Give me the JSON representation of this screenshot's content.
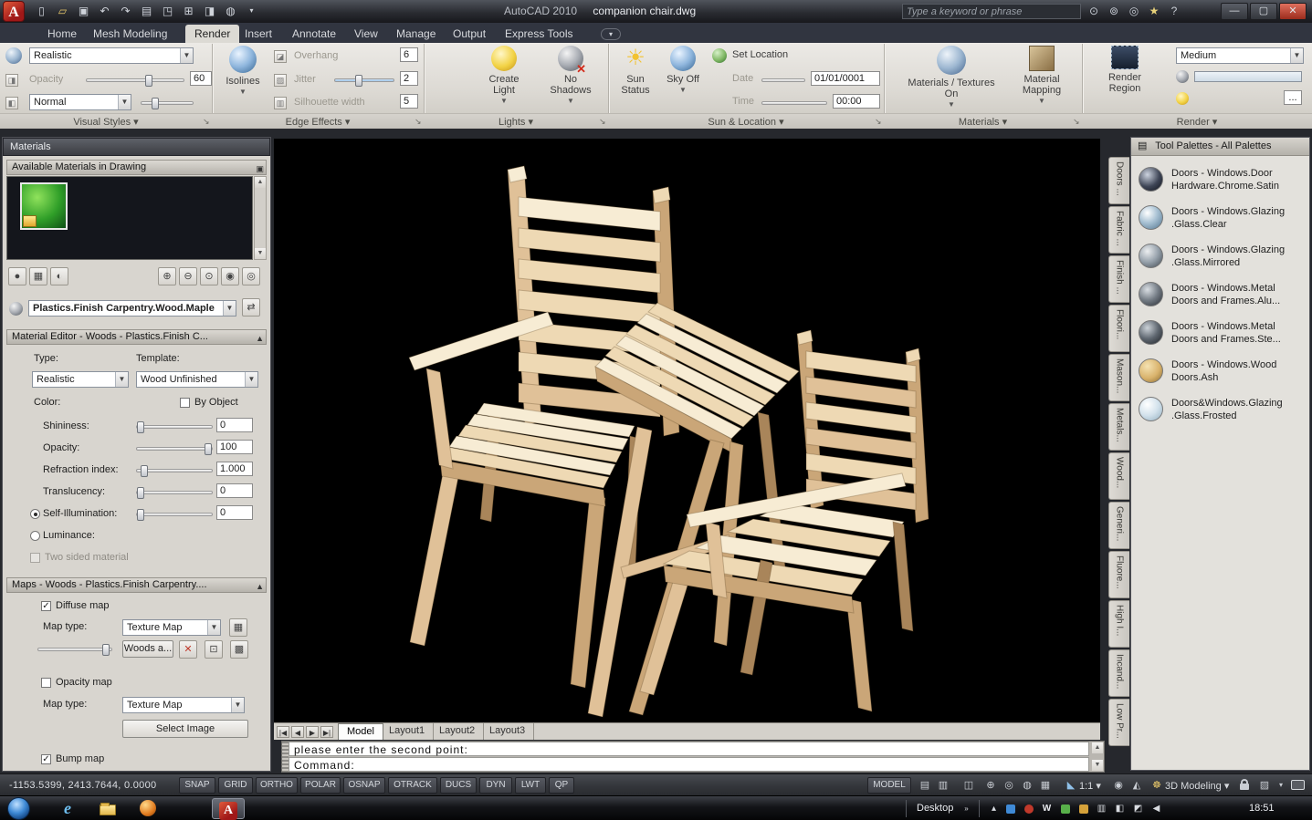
{
  "titlebar": {
    "app_title": "AutoCAD 2010",
    "doc_title": "companion chair.dwg",
    "search_placeholder": "Type a keyword or phrase"
  },
  "ribbon": {
    "tabs": [
      "Home",
      "Mesh Modeling",
      "Render",
      "Insert",
      "Annotate",
      "View",
      "Manage",
      "Output",
      "Express Tools"
    ],
    "visual_styles": {
      "style_value": "Realistic",
      "opacity_label": "Opacity",
      "opacity_value": "60",
      "face_mode_value": "Normal",
      "panel_label": "Visual Styles"
    },
    "edge_effects": {
      "isolines_label": "Isolines",
      "rows": [
        {
          "label": "Overhang",
          "value": "6"
        },
        {
          "label": "Jitter",
          "value": "2"
        },
        {
          "label": "Silhouette width",
          "value": "5"
        }
      ],
      "panel_label": "Edge Effects"
    },
    "lights": {
      "create_light": "Create Light",
      "no_shadows": "No Shadows",
      "panel_label": "Lights"
    },
    "sun_location": {
      "sun_status": "Sun Status",
      "sky_off": "Sky Off",
      "set_location": "Set Location",
      "date_label": "Date",
      "date_value": "01/01/0001",
      "time_label": "Time",
      "time_value": "00:00",
      "panel_label": "Sun & Location"
    },
    "materials": {
      "textures_on": "Materials / Textures On",
      "mapping": "Material Mapping",
      "panel_label": "Materials"
    },
    "render": {
      "region": "Render Region",
      "quality_value": "Medium",
      "more_label": "...",
      "panel_label": "Render"
    }
  },
  "materials_palette": {
    "title": "Materials",
    "header": "Available Materials in Drawing",
    "swatch_style": "background: radial-gradient(circle at 35% 30%, #90e25c, #2f9e28 55%, #0f4f16)",
    "material_combo_value": "Plastics.Finish Carpentry.Wood.Maple",
    "editor_header": "Material Editor - Woods - Plastics.Finish C...",
    "type_label": "Type:",
    "type_value": "Realistic",
    "template_label": "Template:",
    "template_value": "Wood Unfinished",
    "color_label": "Color:",
    "color_swatch_style": "background:#e9c9a3",
    "by_object_label": "By Object",
    "sliders": [
      {
        "label": "Shininess:",
        "value": "0"
      },
      {
        "label": "Opacity:",
        "value": "100"
      },
      {
        "label": "Refraction index:",
        "value": "1.000"
      },
      {
        "label": "Translucency:",
        "value": "0"
      },
      {
        "label": "Self-Illumination:",
        "value": "0"
      }
    ],
    "luminance_label": "Luminance:",
    "two_sided_label": "Two sided material",
    "maps_header": "Maps - Woods - Plastics.Finish Carpentry....",
    "diffuse_map_label": "Diffuse map",
    "map_type_label": "Map type:",
    "map_type_value": "Texture Map",
    "texture_button_label": "Woods a...",
    "opacity_map_label": "Opacity map",
    "map_type2_label": "Map type:",
    "map_type2_value": "Texture Map",
    "select_image_label": "Select Image",
    "bump_map_label": "Bump map"
  },
  "viewport": {
    "layout_tabs": [
      "Model",
      "Layout1",
      "Layout2",
      "Layout3"
    ],
    "background": "#000000",
    "wood_colors": [
      "#f7ecd4",
      "#eed9b4",
      "#e0c198",
      "#caa678",
      "#a9855a",
      "#8a6a45"
    ]
  },
  "command_line": {
    "line1": "please enter the second point:",
    "line2": "Command:"
  },
  "status_bar": {
    "coordinates": "-1153.5399, 2413.7644, 0.0000",
    "toggles": [
      "SNAP",
      "GRID",
      "ORTHO",
      "POLAR",
      "OSNAP",
      "OTRACK",
      "DUCS",
      "DYN",
      "LWT",
      "QP"
    ],
    "model_label": "MODEL",
    "annotation_scale": "1:1",
    "workspace": "3D Modeling"
  },
  "tool_palettes": {
    "title": "Tool Palettes - All Palettes",
    "tabs": [
      "Doors ...",
      "Fabric ...",
      "Finish ...",
      "Floori...",
      "Mason...",
      "Metals...",
      "Wood...",
      "Generi...",
      "Fluore...",
      "High I...",
      "Incand...",
      "Low Pr..."
    ],
    "items": [
      {
        "line1": "Doors - Windows.Door",
        "line2": "Hardware.Chrome.Satin",
        "icon_style": "background: radial-gradient(circle at 35% 30%, #cdd4e0, #3e4556 55%, #10121a)"
      },
      {
        "line1": "Doors - Windows.Glazing",
        "line2": ".Glass.Clear",
        "icon_style": "background: radial-gradient(circle at 35% 30%, #ffffff, #a9c2d4 45%, #51748e)"
      },
      {
        "line1": "Doors - Windows.Glazing",
        "line2": ".Glass.Mirrored",
        "icon_style": "background: radial-gradient(circle at 35% 30%, #eceef0, #96a1ab 50%, #3f474f)"
      },
      {
        "line1": "Doors - Windows.Metal",
        "line2": "Doors and Frames.Alu...",
        "icon_style": "background: radial-gradient(circle at 35% 30%, #d9dee3, #737b84 50%, #262a30)"
      },
      {
        "line1": "Doors - Windows.Metal",
        "line2": "Doors and Frames.Ste...",
        "icon_style": "background: radial-gradient(circle at 35% 30%, #ccd2d8, #5f6770 50%, #1d2126)"
      },
      {
        "line1": "Doors - Windows.Wood",
        "line2": "Doors.Ash",
        "icon_style": "background: radial-gradient(circle at 35% 30%, #f4e2b2, #d9b36c 55%, #8a6a30)"
      },
      {
        "line1": "Doors&Windows.Glazing",
        "line2": ".Glass.Frosted",
        "icon_style": "background: radial-gradient(circle at 35% 30%, #ffffff, #d3e2ec 50%, #93afc0)"
      }
    ]
  },
  "taskbar": {
    "desktop_label": "Desktop",
    "time": "18:51"
  }
}
